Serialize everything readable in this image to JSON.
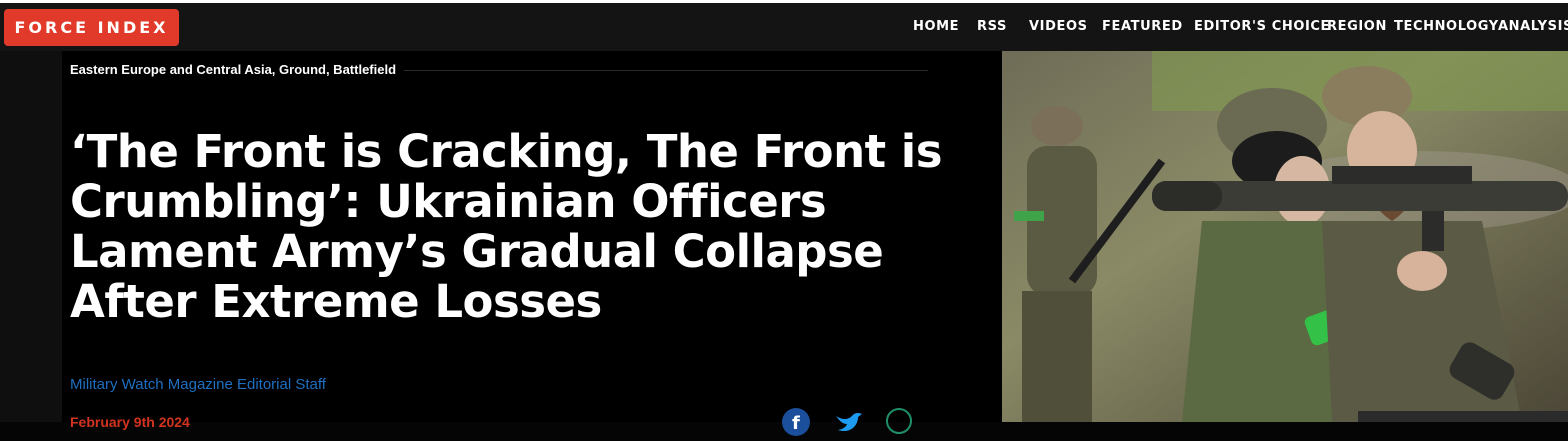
{
  "site": {
    "logo": "FORCE INDEX"
  },
  "nav": {
    "items": [
      {
        "label": "HOME"
      },
      {
        "label": "RSS"
      },
      {
        "label": "VIDEOS"
      },
      {
        "label": "FEATURED"
      },
      {
        "label": "EDITOR'S CHOICE"
      },
      {
        "label": "REGION"
      },
      {
        "label": "TECHNOLOGY"
      },
      {
        "label": "ANALYSIS"
      }
    ]
  },
  "article": {
    "categories": "Eastern Europe and Central Asia, Ground, Battlefield",
    "headline": "‘The Front is Cracking, The Front is Crumbling’: Ukrainian Officers Lament Army’s Gradual Collapse After Extreme Losses",
    "byline": "Military Watch Magazine Editorial Staff",
    "date": "February 9th 2024"
  },
  "share": {
    "icons": [
      "facebook-icon",
      "twitter-icon",
      "whatsapp-icon"
    ]
  },
  "colors": {
    "logo_bg": "#e23a2a",
    "nav_bg": "#141414",
    "byline": "#1e6fc1",
    "date": "#d2331f"
  }
}
